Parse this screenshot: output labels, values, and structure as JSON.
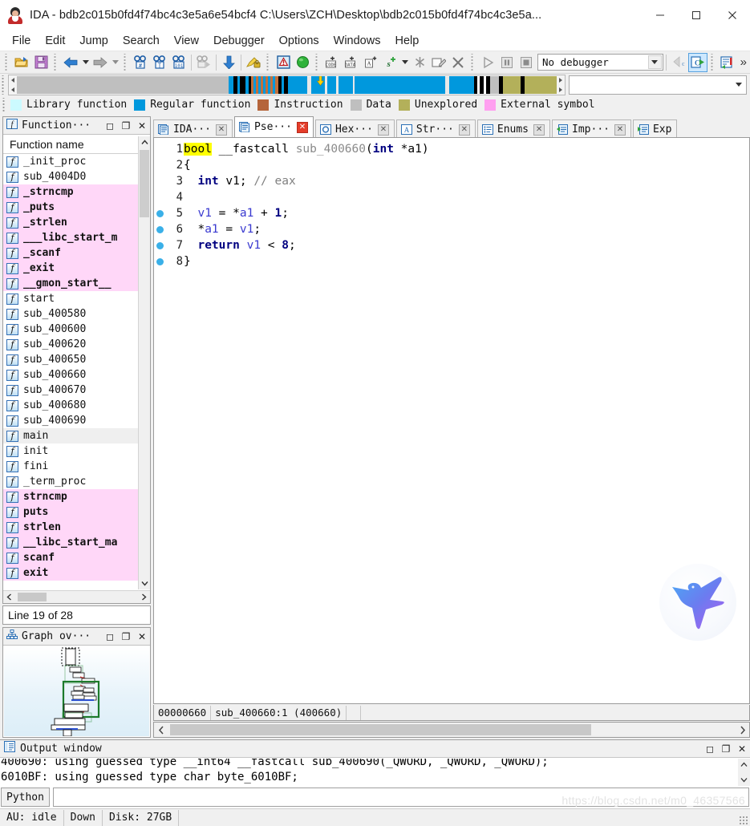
{
  "window": {
    "title": "IDA - bdb2c015b0fd4f74bc4c3e5a6e54bcf4 C:\\Users\\ZCH\\Desktop\\bdb2c015b0fd4f74bc4c3e5a...",
    "minimize_label": "–",
    "maximize_label": "☐",
    "close_label": "✕"
  },
  "menu": {
    "items": [
      "File",
      "Edit",
      "Jump",
      "Search",
      "View",
      "Debugger",
      "Options",
      "Windows",
      "Help"
    ]
  },
  "toolbar": {
    "debugger_value": "No debugger",
    "overflow_label": "»",
    "buttons": [
      "open-file",
      "save-file",
      "back-nav",
      "forward-nav",
      "search-hash",
      "search-text",
      "search-binary",
      "search-next",
      "jump-down",
      "mark-position",
      "warning-toggle",
      "run-ok",
      "make-code",
      "make-data",
      "make-array",
      "make-string",
      "undefine",
      "edit-function",
      "delete-item",
      "run-debugger",
      "pause-debugger",
      "stop-debugger",
      "decompile-prev",
      "decompile-current",
      "open-structures"
    ]
  },
  "navband": {
    "cursor_position_pct": 55.6,
    "segments": [
      {
        "color": "#bfbfbf",
        "width": 39.8
      },
      {
        "color": "#0098dd",
        "width": 1.0
      },
      {
        "color": "#000000",
        "width": 0.7
      },
      {
        "color": "#0098dd",
        "width": 0.5
      },
      {
        "color": "#000000",
        "width": 1.0
      },
      {
        "color": "#0098dd",
        "width": 0.6
      },
      {
        "color": "#000000",
        "width": 0.5
      },
      {
        "color": "#c1703c",
        "width": 0.5
      },
      {
        "color": "#0098dd",
        "width": 0.4
      },
      {
        "color": "#c1703c",
        "width": 0.5
      },
      {
        "color": "#0098dd",
        "width": 0.4
      },
      {
        "color": "#c1703c",
        "width": 0.5
      },
      {
        "color": "#0098dd",
        "width": 0.4
      },
      {
        "color": "#c1703c",
        "width": 0.5
      },
      {
        "color": "#0098dd",
        "width": 0.4
      },
      {
        "color": "#c1703c",
        "width": 0.5
      },
      {
        "color": "#0098dd",
        "width": 0.4
      },
      {
        "color": "#c1703c",
        "width": 0.6
      },
      {
        "color": "#000000",
        "width": 0.6
      },
      {
        "color": "#0098dd",
        "width": 0.5
      },
      {
        "color": "#000000",
        "width": 0.8
      },
      {
        "color": "#0098dd",
        "width": 3.6
      },
      {
        "color": "#e8e8e8",
        "width": 0.7
      },
      {
        "color": "#0098dd",
        "width": 2.6
      },
      {
        "color": "#e8e8e8",
        "width": 0.5
      },
      {
        "color": "#0098dd",
        "width": 1.6
      },
      {
        "color": "#e8e8e8",
        "width": 0.5
      },
      {
        "color": "#0098dd",
        "width": 2.6
      },
      {
        "color": "#e8e8e8",
        "width": 0.4
      },
      {
        "color": "#0098dd",
        "width": 17.0
      },
      {
        "color": "#e8e8e8",
        "width": 0.8
      },
      {
        "color": "#0098dd",
        "width": 4.6
      },
      {
        "color": "#000000",
        "width": 0.7
      },
      {
        "color": "#ffffff",
        "width": 0.4
      },
      {
        "color": "#000000",
        "width": 0.8
      },
      {
        "color": "#ffffff",
        "width": 0.4
      },
      {
        "color": "#000000",
        "width": 0.8
      },
      {
        "color": "#bfbfbf",
        "width": 1.6
      },
      {
        "color": "#000000",
        "width": 0.8
      },
      {
        "color": "#b3b05a",
        "width": 3.3
      },
      {
        "color": "#000000",
        "width": 0.8
      },
      {
        "color": "#b3b05a",
        "width": 6.0
      }
    ]
  },
  "legend": {
    "items": [
      {
        "label": "Library function",
        "color": "#ccfaff"
      },
      {
        "label": "Regular function",
        "color": "#0098dd"
      },
      {
        "label": "Instruction",
        "color": "#b5653b"
      },
      {
        "label": "Data",
        "color": "#bfbfbf"
      },
      {
        "label": "Unexplored",
        "color": "#b3b05a"
      },
      {
        "label": "External symbol",
        "color": "#ff9ff0"
      }
    ]
  },
  "functions_panel": {
    "title": "Function···",
    "column_header": "Function name",
    "line_status": "Line 19 of 28",
    "items": [
      {
        "name": "_init_proc",
        "kind": "normal"
      },
      {
        "name": "sub_4004D0",
        "kind": "normal"
      },
      {
        "name": "_strncmp",
        "kind": "library"
      },
      {
        "name": "_puts",
        "kind": "library"
      },
      {
        "name": "_strlen",
        "kind": "library"
      },
      {
        "name": "___libc_start_m",
        "kind": "library"
      },
      {
        "name": "_scanf",
        "kind": "library"
      },
      {
        "name": "_exit",
        "kind": "library"
      },
      {
        "name": "__gmon_start__",
        "kind": "library"
      },
      {
        "name": "start",
        "kind": "normal"
      },
      {
        "name": "sub_400580",
        "kind": "normal"
      },
      {
        "name": "sub_400600",
        "kind": "normal"
      },
      {
        "name": "sub_400620",
        "kind": "normal"
      },
      {
        "name": "sub_400650",
        "kind": "normal"
      },
      {
        "name": "sub_400660",
        "kind": "normal"
      },
      {
        "name": "sub_400670",
        "kind": "normal"
      },
      {
        "name": "sub_400680",
        "kind": "normal"
      },
      {
        "name": "sub_400690",
        "kind": "normal"
      },
      {
        "name": "main",
        "kind": "selected"
      },
      {
        "name": "init",
        "kind": "normal"
      },
      {
        "name": "fini",
        "kind": "normal"
      },
      {
        "name": "_term_proc",
        "kind": "normal"
      },
      {
        "name": "strncmp",
        "kind": "library"
      },
      {
        "name": "puts",
        "kind": "library"
      },
      {
        "name": "strlen",
        "kind": "library"
      },
      {
        "name": "__libc_start_ma",
        "kind": "library"
      },
      {
        "name": "scanf",
        "kind": "library"
      },
      {
        "name": "exit",
        "kind": "library"
      }
    ]
  },
  "graph_panel": {
    "title": "Graph ov···"
  },
  "tabs": [
    {
      "label": "IDA···",
      "icon": "view-document-icon",
      "active": false
    },
    {
      "label": "Pse···",
      "icon": "pseudocode-icon",
      "active": true
    },
    {
      "label": "Hex···",
      "icon": "hexview-icon",
      "active": false
    },
    {
      "label": "Str···",
      "icon": "strings-icon",
      "active": false
    },
    {
      "label": "Enums",
      "icon": "enums-icon",
      "active": false
    },
    {
      "label": "Imp···",
      "icon": "imports-icon",
      "active": false
    },
    {
      "label": "Exp",
      "icon": "exports-icon",
      "active": false
    }
  ],
  "pseudocode": {
    "lines": [
      {
        "no": "1",
        "breakpoint": false,
        "tokens": [
          {
            "t": "bool",
            "c": "hl"
          },
          {
            "t": " __fastcall ",
            "c": "plain"
          },
          {
            "t": "sub_400660",
            "c": "fn"
          },
          {
            "t": "(",
            "c": "plain"
          },
          {
            "t": "int",
            "c": "kw"
          },
          {
            "t": " *a1)",
            "c": "plain"
          }
        ]
      },
      {
        "no": "2",
        "breakpoint": false,
        "tokens": [
          {
            "t": "{",
            "c": "plain"
          }
        ]
      },
      {
        "no": "3",
        "breakpoint": false,
        "tokens": [
          {
            "t": "  ",
            "c": "plain"
          },
          {
            "t": "int",
            "c": "kw"
          },
          {
            "t": " v1; ",
            "c": "plain"
          },
          {
            "t": "// eax",
            "c": "cmt"
          }
        ]
      },
      {
        "no": "4",
        "breakpoint": false,
        "tokens": [
          {
            "t": "",
            "c": "plain"
          }
        ]
      },
      {
        "no": "5",
        "breakpoint": true,
        "tokens": [
          {
            "t": "  ",
            "c": "plain"
          },
          {
            "t": "v1",
            "c": "var"
          },
          {
            "t": " = *",
            "c": "plain"
          },
          {
            "t": "a1",
            "c": "var"
          },
          {
            "t": " + ",
            "c": "plain"
          },
          {
            "t": "1",
            "c": "num"
          },
          {
            "t": ";",
            "c": "plain"
          }
        ]
      },
      {
        "no": "6",
        "breakpoint": true,
        "tokens": [
          {
            "t": "  *",
            "c": "plain"
          },
          {
            "t": "a1",
            "c": "var"
          },
          {
            "t": " = ",
            "c": "plain"
          },
          {
            "t": "v1",
            "c": "var"
          },
          {
            "t": ";",
            "c": "plain"
          }
        ]
      },
      {
        "no": "7",
        "breakpoint": true,
        "tokens": [
          {
            "t": "  ",
            "c": "plain"
          },
          {
            "t": "return",
            "c": "kw"
          },
          {
            "t": " ",
            "c": "plain"
          },
          {
            "t": "v1",
            "c": "var"
          },
          {
            "t": " < ",
            "c": "plain"
          },
          {
            "t": "8",
            "c": "num"
          },
          {
            "t": ";",
            "c": "plain"
          }
        ]
      },
      {
        "no": "8",
        "breakpoint": true,
        "tokens": [
          {
            "t": "}",
            "c": "plain"
          }
        ]
      }
    ],
    "status": {
      "offset": "00000660",
      "location": "sub_400660:1  (400660)"
    }
  },
  "output_window": {
    "title": "Output window",
    "lines": [
      "400690: using guessed type __int64 __fastcall sub_400690(_QWORD, _QWORD, _QWORD);",
      "6010BF: using guessed type char byte_6010BF;"
    ],
    "cli_label": "Python",
    "cli_value": ""
  },
  "statusbar": {
    "cells": [
      "AU: idle",
      "Down",
      "Disk: 27GB"
    ]
  },
  "watermark": {
    "url": "https://blog.csdn.net/m0_46357566"
  },
  "colors": {
    "accent_blue": "#0098dd",
    "library_pink": "#ffd7f8",
    "highlight_yellow": "#ffff00",
    "breakpoint_blue": "#3ab0e8",
    "unexplored": "#b3b05a"
  }
}
